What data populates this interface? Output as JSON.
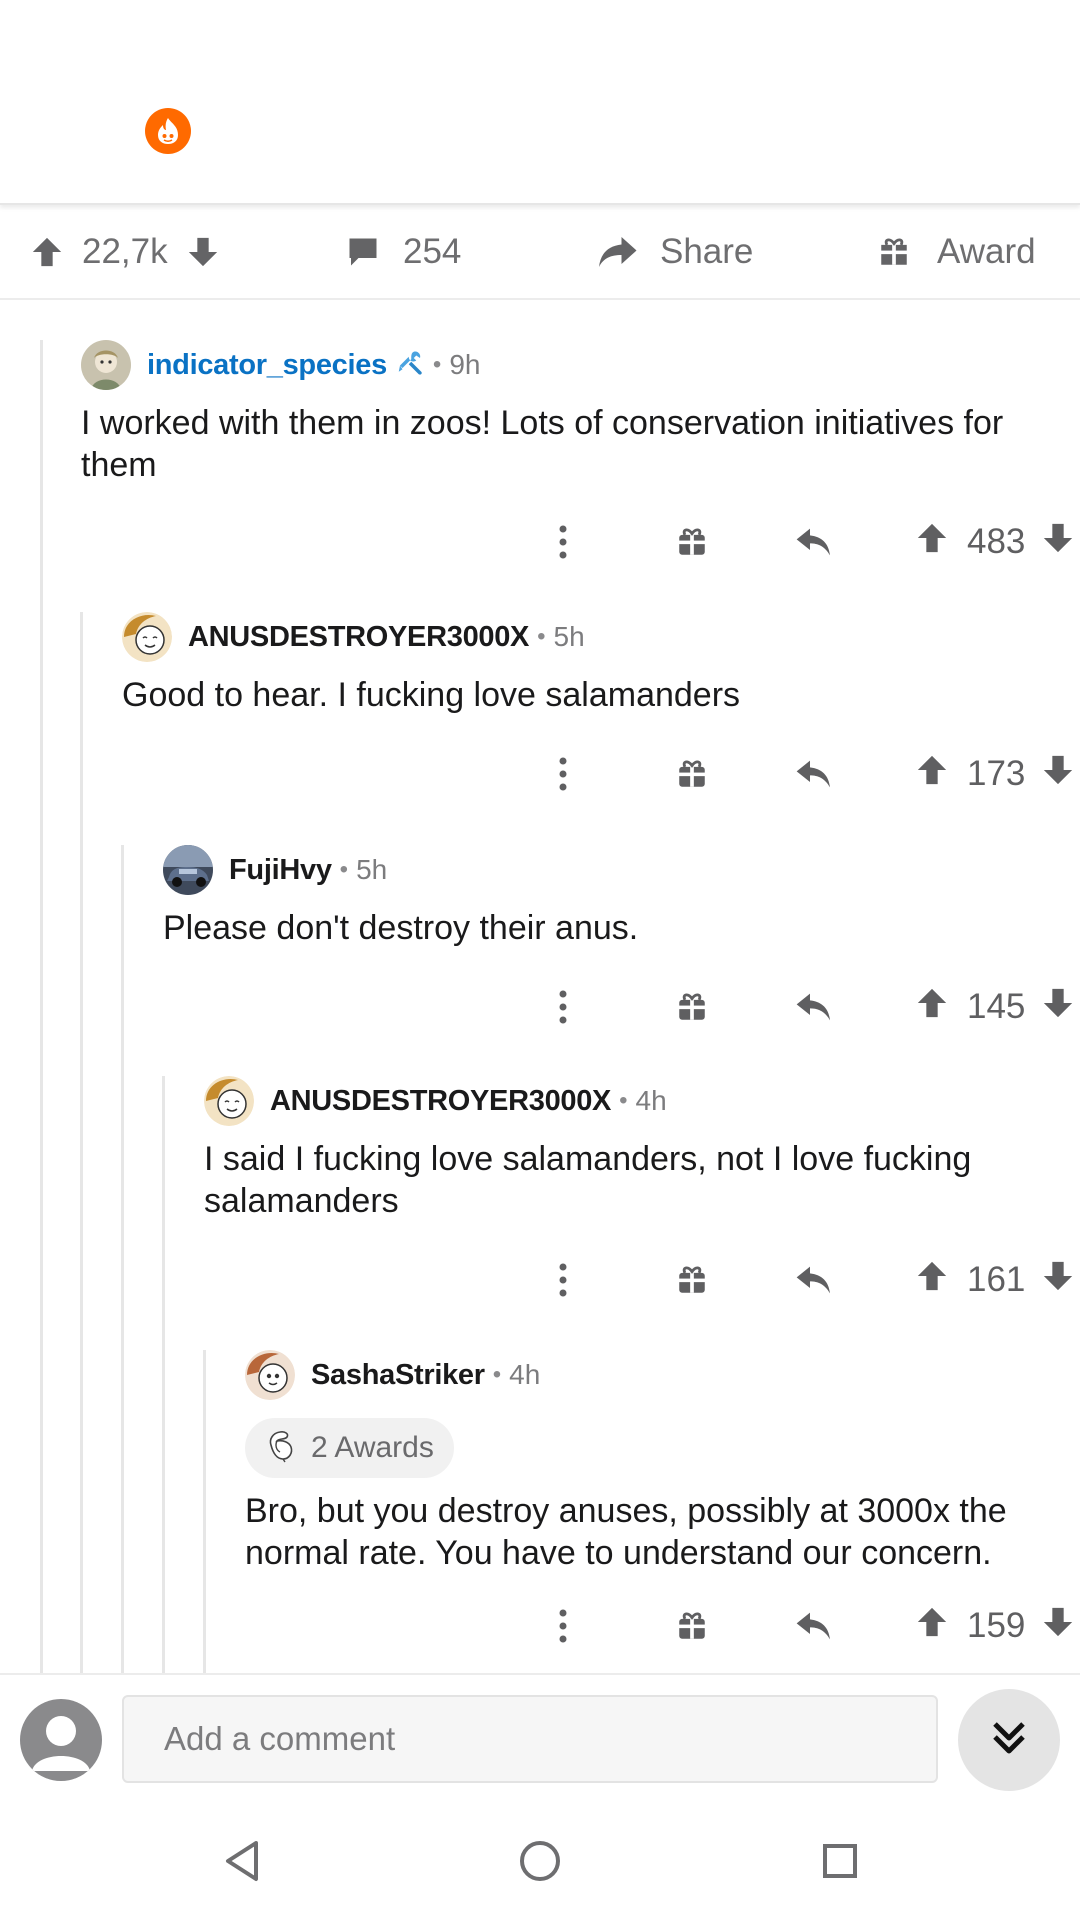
{
  "post_bar": {
    "upvotes": "22,7k",
    "comments": "254",
    "share_label": "Share",
    "award_label": "Award"
  },
  "comments": [
    {
      "username": "indicator_species",
      "time": "9h",
      "body": "I worked with them in zoos! Lots of conservation initiatives for them",
      "votes": "483"
    },
    {
      "username": "ANUSDESTROYER3000X",
      "time": "5h",
      "body": "Good to hear. I fucking love salamanders",
      "votes": "173"
    },
    {
      "username": "FujiHvy",
      "time": "5h",
      "body": "Please don't destroy their anus.",
      "votes": "145"
    },
    {
      "username": "ANUSDESTROYER3000X",
      "time": "4h",
      "body": "I said I fucking love salamanders, not I love fucking salamanders",
      "votes": "161"
    },
    {
      "username": "SashaStriker",
      "time": "4h",
      "awards": "2 Awards",
      "body": "Bro, but you destroy anuses, possibly at 3000x the normal rate. You have to understand our concern.",
      "votes": "159"
    }
  ],
  "comment_bar": {
    "placeholder": "Add a comment"
  },
  "colors": {
    "accent_blue": "#0a72c4",
    "subreddit_icon": "#ff6a00",
    "icon_gray": "#5f5f61"
  }
}
